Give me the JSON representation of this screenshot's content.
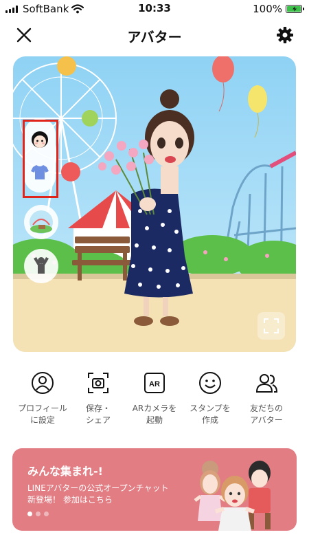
{
  "status": {
    "carrier": "SoftBank",
    "time": "10:33",
    "battery": "100%"
  },
  "nav": {
    "title": "アバター"
  },
  "actions": [
    {
      "label": "プロフィール\nに設定",
      "icon": "profile-icon"
    },
    {
      "label": "保存・\nシェア",
      "icon": "camera-save-icon"
    },
    {
      "label": "ARカメラを\n起動",
      "icon": "ar-icon",
      "icon_text": "AR"
    },
    {
      "label": "スタンプを\n作成",
      "icon": "smile-icon"
    },
    {
      "label": "友だちの\nアバター",
      "icon": "friends-icon"
    }
  ],
  "banner": {
    "title": "みんな集まれ-!",
    "subtitle": "LINEアバターの公式オープンチャット\n新登場！ 参加はこちら",
    "page_count": 3,
    "active_page": 1
  },
  "colors": {
    "banner": "#e17d83",
    "highlight": "#e0261c",
    "pill_shirt": "#6f8fe0",
    "battery": "#3cc04a"
  }
}
